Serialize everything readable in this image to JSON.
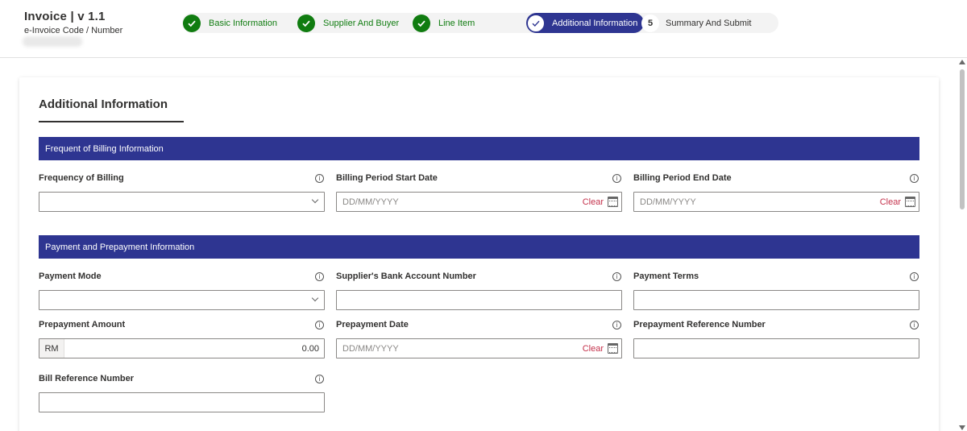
{
  "header": {
    "title": "Invoice | v 1.1",
    "subtitle": "e-Invoice Code / Number"
  },
  "steps": [
    {
      "label": "Basic Information",
      "state": "done"
    },
    {
      "label": "Supplier And Buyer",
      "state": "done"
    },
    {
      "label": "Line Item",
      "state": "done"
    },
    {
      "label": "Additional Information",
      "state": "active"
    },
    {
      "number": "5",
      "label": "Summary And Submit",
      "state": "pending"
    }
  ],
  "card": {
    "title": "Additional Information"
  },
  "sections": {
    "billing": {
      "title": "Frequent of Billing Information",
      "frequency_label": "Frequency of Billing",
      "start_label": "Billing Period Start Date",
      "start_placeholder": "DD/MM/YYYY",
      "end_label": "Billing Period End Date",
      "end_placeholder": "DD/MM/YYYY"
    },
    "payment": {
      "title": "Payment and Prepayment Information",
      "mode_label": "Payment Mode",
      "bank_label": "Supplier's Bank Account Number",
      "terms_label": "Payment Terms",
      "prepay_amount_label": "Prepayment Amount",
      "currency": "RM",
      "prepay_amount_value": "0.00",
      "prepay_date_label": "Prepayment Date",
      "prepay_date_placeholder": "DD/MM/YYYY",
      "prepay_ref_label": "Prepayment Reference Number",
      "bill_ref_label": "Bill Reference Number"
    }
  },
  "common": {
    "clear_label": "Clear",
    "info_glyph": "i"
  },
  "colors": {
    "primary": "#2e3591",
    "success": "#107c10",
    "danger": "#c4314b"
  }
}
